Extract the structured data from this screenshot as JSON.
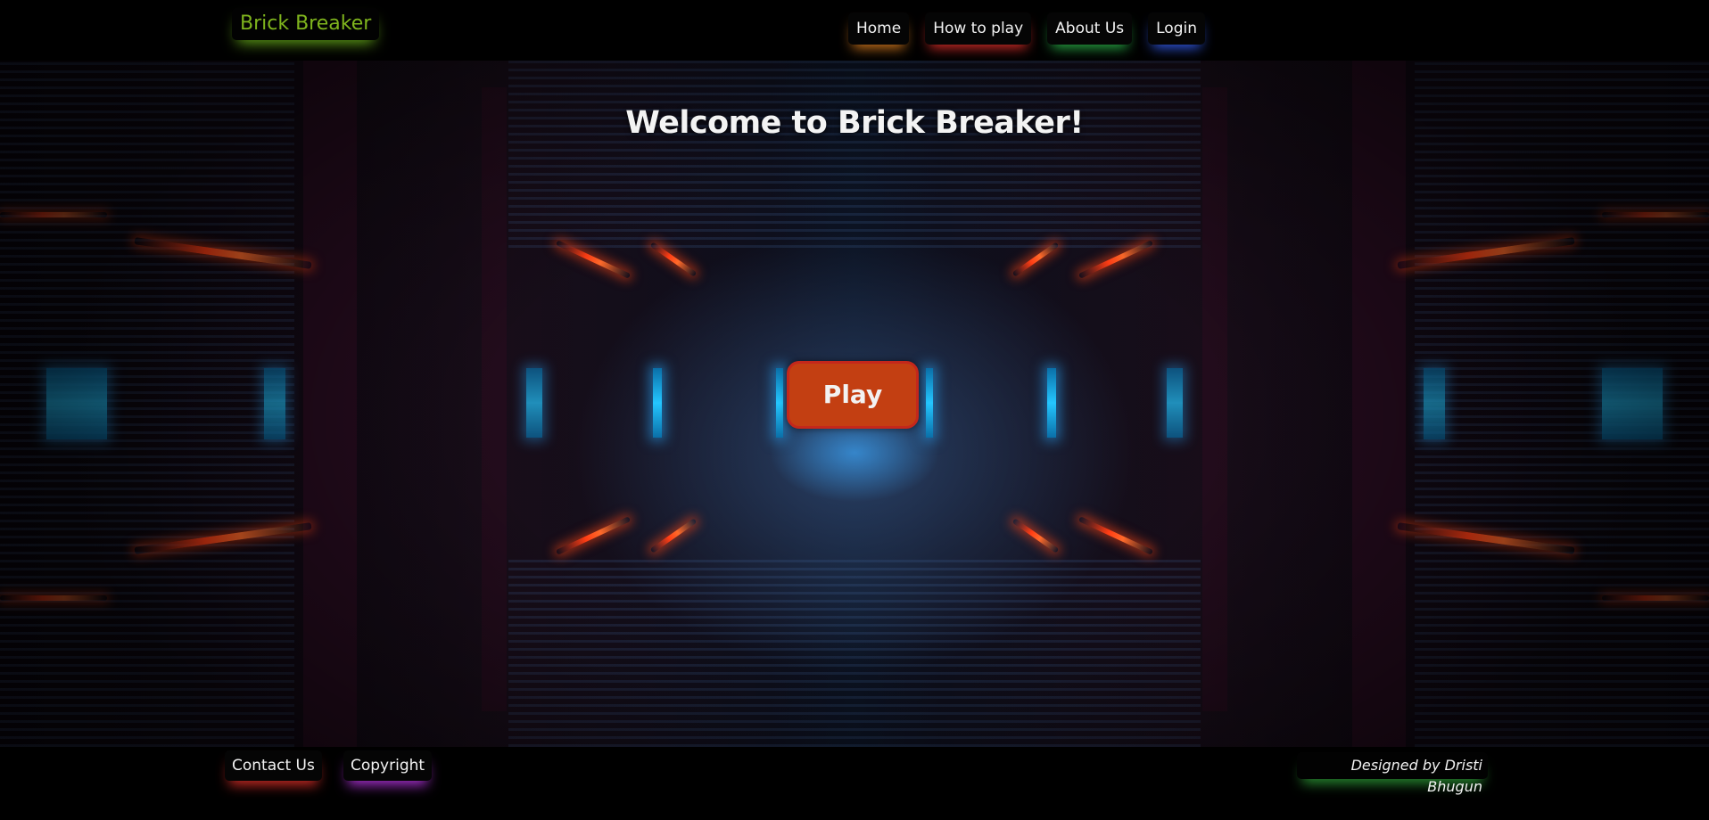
{
  "header": {
    "logo": "Brick Breaker",
    "nav": [
      {
        "label": "Home",
        "accent": "#d2781e"
      },
      {
        "label": "How to play",
        "accent": "#d72d28"
      },
      {
        "label": "About Us",
        "accent": "#28aa46"
      },
      {
        "label": "Login",
        "accent": "#325ae6"
      }
    ]
  },
  "main": {
    "title": "Welcome to Brick Breaker!",
    "play_label": "Play",
    "play_color": "#c33f12"
  },
  "footer": {
    "links": [
      {
        "label": "Contact Us",
        "accent": "#d72d28"
      },
      {
        "label": "Copyright",
        "accent": "#aa32d2"
      }
    ],
    "credit": "Designed by Dristi Bhugun"
  },
  "colors": {
    "logo": "#7fb41d",
    "background": "#000000",
    "text": "#f2f2f2"
  }
}
